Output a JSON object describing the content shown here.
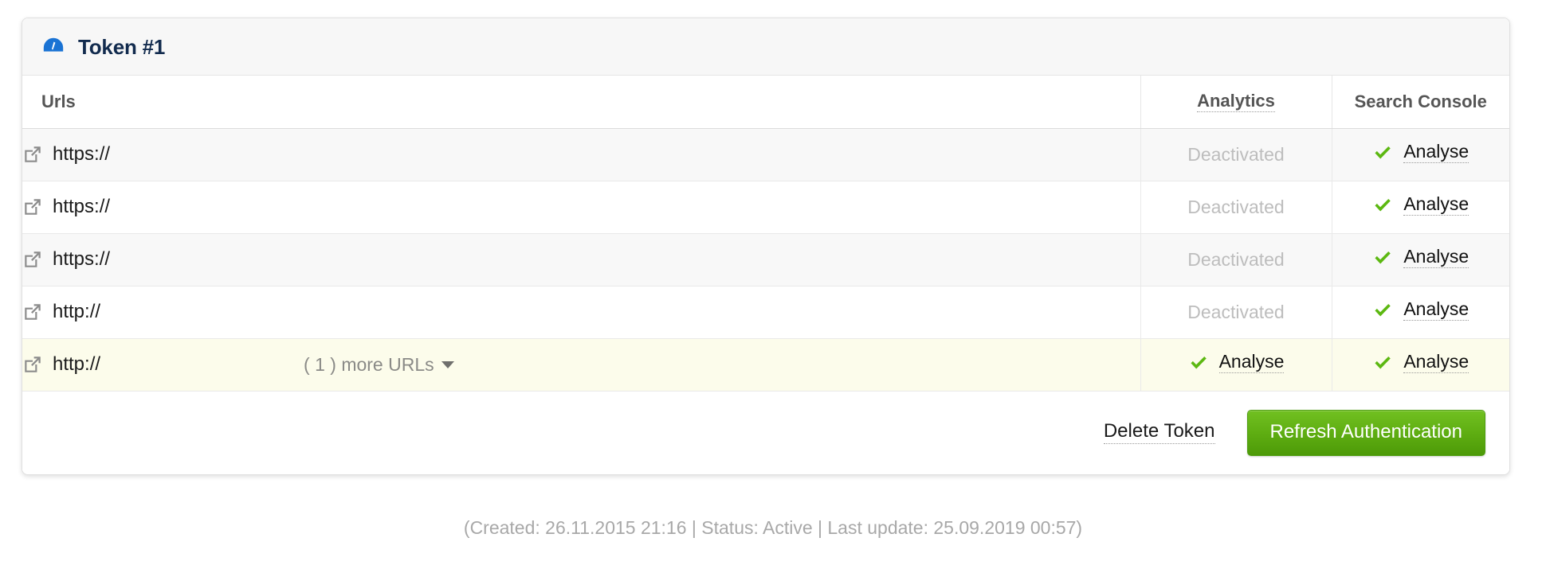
{
  "card": {
    "title": "Token #1",
    "icon": "gauge-icon"
  },
  "table": {
    "columns": [
      {
        "key": "urls",
        "label": "Urls",
        "dotted": false
      },
      {
        "key": "analytics",
        "label": "Analytics",
        "dotted": true
      },
      {
        "key": "search_console",
        "label": "Search Console",
        "dotted": false
      }
    ],
    "rows": [
      {
        "url": "https://",
        "link_icon": "external-link-icon",
        "more_urls": "",
        "analytics": {
          "status": "Deactivated",
          "has_check": false
        },
        "search_console": {
          "status": "Analyse",
          "has_check": true
        },
        "highlighted": false
      },
      {
        "url": "https://",
        "link_icon": "external-link-icon",
        "more_urls": "",
        "analytics": {
          "status": "Deactivated",
          "has_check": false
        },
        "search_console": {
          "status": "Analyse",
          "has_check": true
        },
        "highlighted": false
      },
      {
        "url": "https://",
        "link_icon": "external-link-icon",
        "more_urls": "",
        "analytics": {
          "status": "Deactivated",
          "has_check": false
        },
        "search_console": {
          "status": "Analyse",
          "has_check": true
        },
        "highlighted": false
      },
      {
        "url": "http://",
        "link_icon": "external-link-icon",
        "more_urls": "",
        "analytics": {
          "status": "Deactivated",
          "has_check": false
        },
        "search_console": {
          "status": "Analyse",
          "has_check": true
        },
        "highlighted": false
      },
      {
        "url": "http://",
        "link_icon": "external-link-icon",
        "more_urls": "( 1 ) more URLs",
        "analytics": {
          "status": "Analyse",
          "has_check": true
        },
        "search_console": {
          "status": "Analyse",
          "has_check": true
        },
        "highlighted": true
      }
    ]
  },
  "footer": {
    "delete_label": "Delete Token",
    "refresh_label": "Refresh Authentication"
  },
  "meta": {
    "line": "(Created: 26.11.2015 21:16 | Status: Active | Last update: 25.09.2019 00:57)"
  },
  "colors": {
    "accent_blue": "#1a73d4",
    "title_navy": "#122b4e",
    "check_green": "#5cb811",
    "button_green": "#5fae12",
    "highlight_row": "#fcfceb",
    "muted_text": "#bdbdbd"
  }
}
